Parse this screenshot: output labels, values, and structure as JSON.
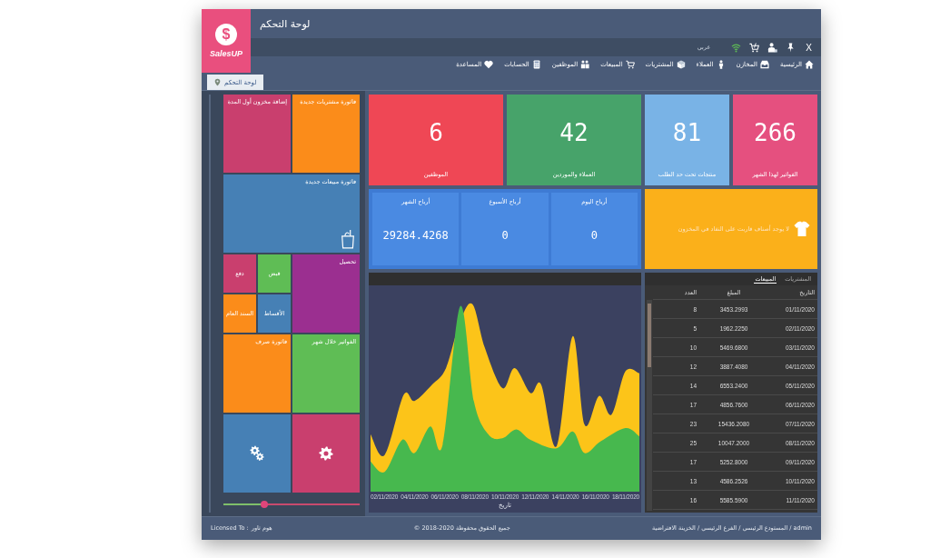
{
  "window": {
    "title": "لوحة التحكم",
    "logo": {
      "mark": "$",
      "wordmark": "SalesUP"
    }
  },
  "toolbar": {
    "close": "X",
    "language": "عربي"
  },
  "menu": [
    "الرئيسية",
    "المخازن",
    "العملاء",
    "المشتريات",
    "المبيعات",
    "الموظفين",
    "الحسابات",
    "المساعدة"
  ],
  "tabs": [
    {
      "label": "لوحة التحكم",
      "selected": true
    }
  ],
  "tiles": [
    {
      "kind": "medium",
      "label": "فاتورة مشتريات جديدة",
      "color": "#fb8c1a"
    },
    {
      "kind": "medium",
      "label": "إضافة مخزون أول المدة",
      "color": "#c93f6e"
    },
    {
      "kind": "wide",
      "label": "فاتورة مبيعات جديدة",
      "color": "#4680b5"
    },
    {
      "kind": "medium",
      "label": "تحصيل",
      "color": "#9b2f90"
    },
    {
      "kind": "small",
      "label": "قبض",
      "color": "#5fbd55"
    },
    {
      "kind": "small",
      "label": "دفع",
      "color": "#c93f6e"
    },
    {
      "kind": "small",
      "label": "الأقساط",
      "color": "#4680b5"
    },
    {
      "kind": "small",
      "label": "السند العام",
      "color": "#fb8c1a"
    },
    {
      "kind": "medium",
      "label": "الفواتير خلال شهر",
      "color": "#5fbd55"
    },
    {
      "kind": "medium",
      "label": "فاتورة صرف",
      "color": "#fb8c1a"
    },
    {
      "kind": "medium",
      "color": "#c93f6e"
    },
    {
      "kind": "medium",
      "color": "#4680b5"
    }
  ],
  "zoom_slider": {
    "level": 0.3
  },
  "stats": [
    {
      "value": "266",
      "label": "الفواتير لهذا الشهر",
      "color": "#e5507f"
    },
    {
      "value": "81",
      "label": "منتجات تحت حد الطلب",
      "color": "#79b3e6"
    },
    {
      "value": "42",
      "label": "العملاء والموردين",
      "color": "#47a36a"
    },
    {
      "value": "6",
      "label": "الموظفين",
      "color": "#ef4755"
    }
  ],
  "banner": {
    "message": "لا يوجد أصناف قاربت على النفاد في المخزون"
  },
  "profits": [
    {
      "label": "أرباح اليوم",
      "value": "0"
    },
    {
      "label": "أرباح الأسبوع",
      "value": "0"
    },
    {
      "label": "أرباح الشهر",
      "value": "29284.4268"
    }
  ],
  "chart": {
    "x_labels": [
      "18/11/2020",
      "16/11/2020",
      "14/11/2020",
      "12/11/2020",
      "10/11/2020",
      "08/11/2020",
      "06/11/2020",
      "04/11/2020",
      "02/11/2020"
    ],
    "xlabel": "تاريخ"
  },
  "table": {
    "tabs": [
      {
        "label": "المشتريات",
        "selected": false
      },
      {
        "label": "المبيعات",
        "selected": true
      }
    ],
    "columns": [
      "التاريخ",
      "المبلغ",
      "العدد"
    ],
    "rows": [
      [
        "01/11/2020",
        "3453.2993",
        "8"
      ],
      [
        "02/11/2020",
        "1962.2250",
        "5"
      ],
      [
        "03/11/2020",
        "5469.6800",
        "10"
      ],
      [
        "04/11/2020",
        "3887.4080",
        "12"
      ],
      [
        "05/11/2020",
        "6553.2400",
        "14"
      ],
      [
        "06/11/2020",
        "4856.7600",
        "17"
      ],
      [
        "07/11/2020",
        "15436.2080",
        "23"
      ],
      [
        "08/11/2020",
        "10047.2000",
        "25"
      ],
      [
        "09/11/2020",
        "5252.8000",
        "17"
      ],
      [
        "10/11/2020",
        "4586.2526",
        "13"
      ],
      [
        "11/11/2020",
        "5585.5900",
        "16"
      ]
    ]
  },
  "status_bar": {
    "license_label": "Licensed To :",
    "licensee": "هوم تاور",
    "copyright": "© 2018-2020 جميع الحقوق محفوظة",
    "session": "admin / المستودع الرئيسي / الفرع الرئيسي / الخزينة الافتراضية"
  }
}
